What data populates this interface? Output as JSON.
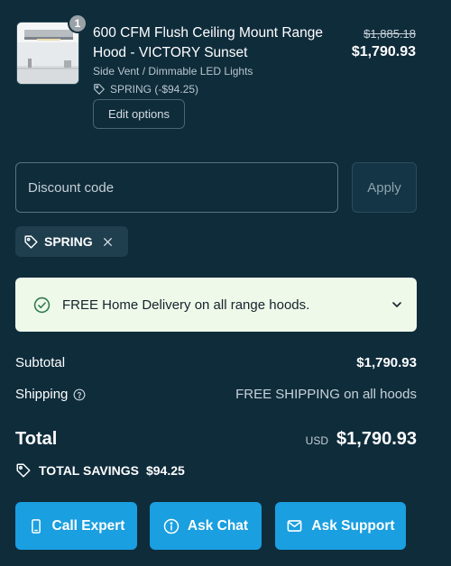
{
  "product": {
    "quantity": "1",
    "title": "600 CFM Flush Ceiling Mount Range Hood - VICTORY Sunset",
    "variant": "Side Vent / Dimmable LED Lights",
    "discount_applied": "SPRING (-$94.25)",
    "edit_label": "Edit options",
    "price_original": "$1,885.18",
    "price_current": "$1,790.93",
    "image_icon": "range-hood-thumbnail"
  },
  "discount": {
    "placeholder": "Discount code",
    "apply_label": "Apply",
    "tag_icon": "tag-icon",
    "applied_code": "SPRING",
    "remove_icon": "close-icon"
  },
  "banner": {
    "text": "FREE Home Delivery on all range hoods.",
    "icon": "check-circle-icon",
    "chevron": "chevron-down-icon",
    "background": "#eef9ea"
  },
  "summary": {
    "subtotal_label": "Subtotal",
    "subtotal_value": "$1,790.93",
    "shipping_label": "Shipping",
    "shipping_value": "FREE SHIPPING on all hoods",
    "total_label": "Total",
    "currency": "USD",
    "total_value": "$1,790.93",
    "savings_label": "TOTAL SAVINGS",
    "savings_value": "$94.25"
  },
  "actions": {
    "call_label": "Call Expert",
    "chat_label": "Ask Chat",
    "support_label": "Ask Support",
    "accent": "#1a9fe0"
  },
  "colors": {
    "background": "#0f2c3b"
  }
}
